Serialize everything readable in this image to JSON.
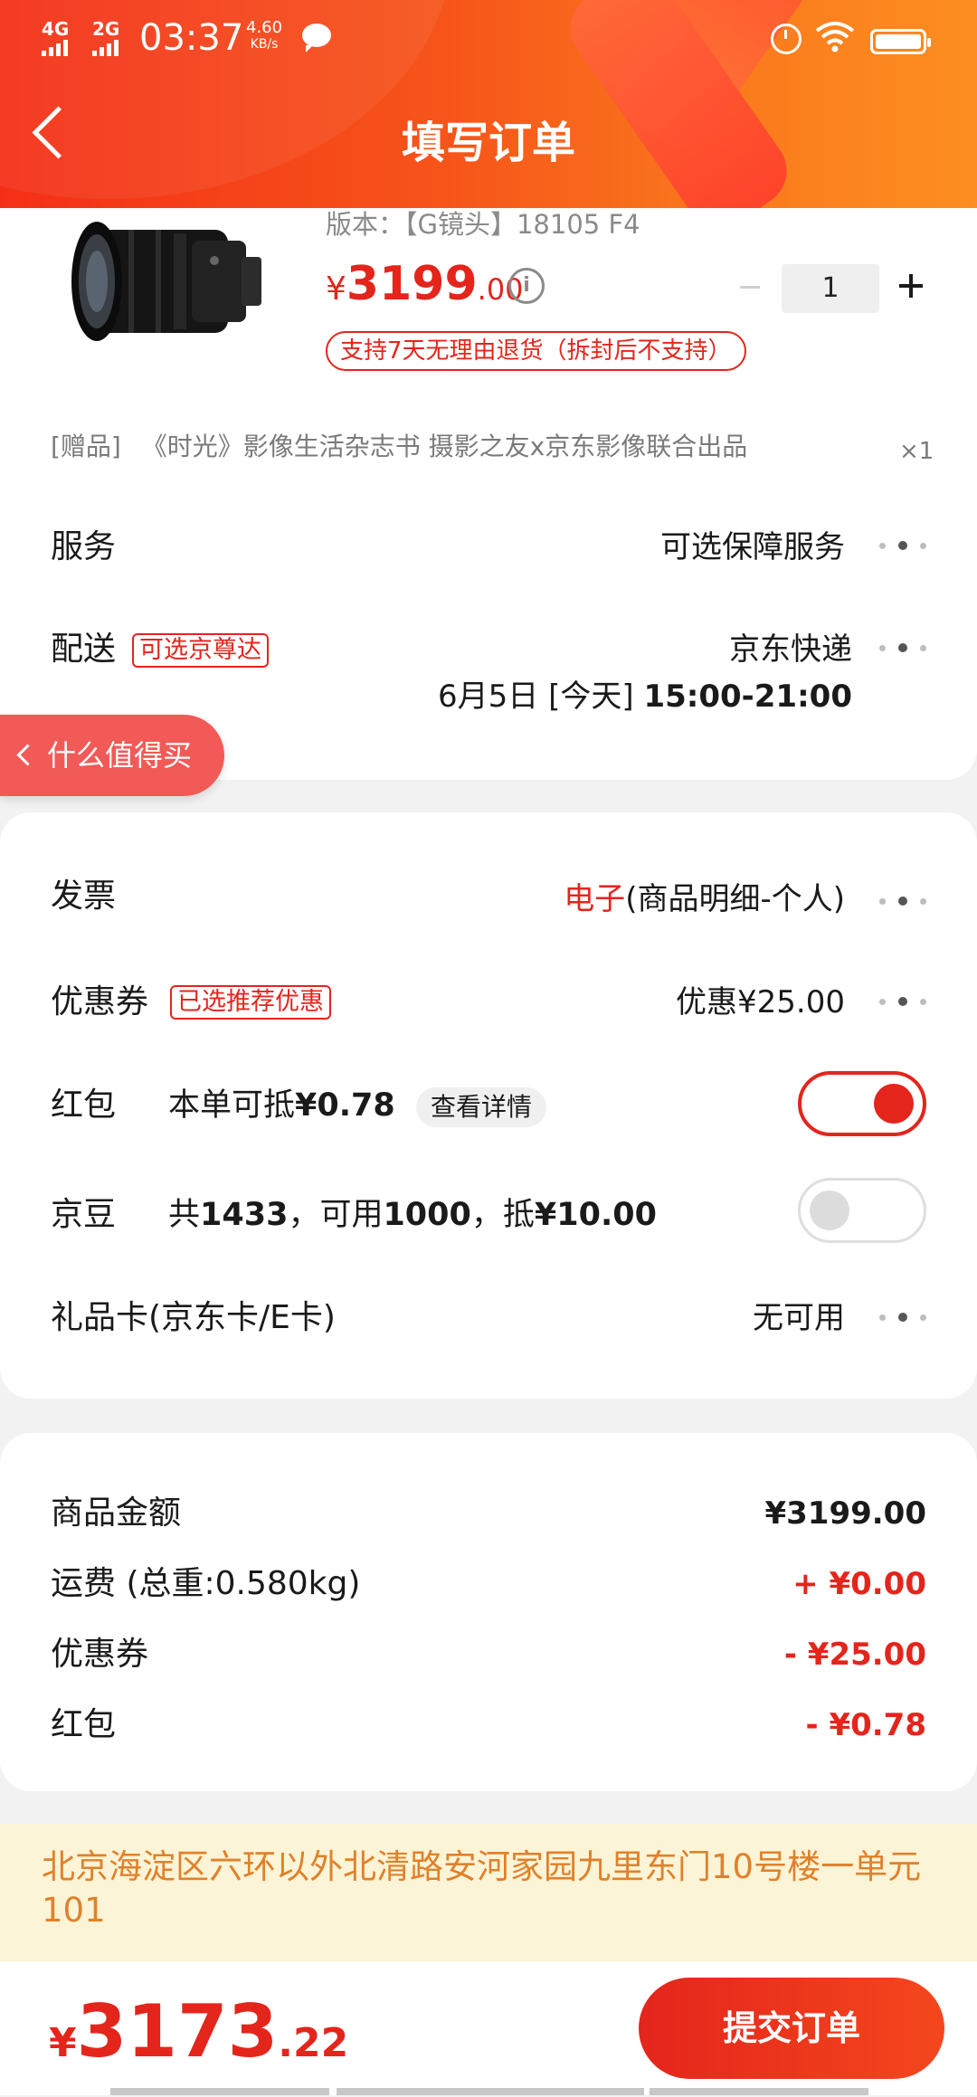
{
  "status_bar": {
    "net1": "4G",
    "net2": "2G",
    "time": "03:37",
    "speed_value": "4.60",
    "speed_unit": "KB/s"
  },
  "header": {
    "title": "填写订单"
  },
  "product": {
    "version": "版本：【G镜头】18105 F4",
    "currency": "¥",
    "price_int": "3199",
    "price_dec": ".00",
    "quantity": "1",
    "return_policy": "支持7天无理由退货（拆封后不支持）"
  },
  "gift": {
    "tag": "[赠品]",
    "name": "《时光》影像生活杂志书 摄影之友x京东影像联合出品",
    "qty": "×1"
  },
  "service": {
    "label": "服务",
    "value": "可选保障服务"
  },
  "delivery": {
    "label": "配送",
    "tag": "可选京尊达",
    "carrier": "京东快递",
    "time_prefix": "6月5日 [今天] ",
    "time_range": "15:00-21:00"
  },
  "floating_tab": {
    "label": "什么值得买"
  },
  "invoice": {
    "label": "发票",
    "type": "电子",
    "detail": "(商品明细-个人)"
  },
  "coupon": {
    "label": "优惠券",
    "tag": "已选推荐优惠",
    "value": "优惠¥25.00"
  },
  "red_packet": {
    "label": "红包",
    "text_prefix": "本单可抵",
    "amount": "¥0.78",
    "details_button": "查看详情",
    "enabled": true
  },
  "jingdou": {
    "label": "京豆",
    "t1": "共",
    "total": "1433",
    "t2": "，可用",
    "usable": "1000",
    "t3": "，抵",
    "deduct": "¥10.00",
    "enabled": false
  },
  "gift_card": {
    "label": "礼品卡(京东卡/E卡)",
    "value": "无可用"
  },
  "summary": {
    "items": [
      {
        "label": "商品金额",
        "value": "¥3199.00",
        "color": "#1a1a1a"
      },
      {
        "label": "运费  (总重:0.580kg)",
        "value": "+ ¥0.00",
        "color": "#e4251c"
      },
      {
        "label": "优惠券",
        "value": "- ¥25.00",
        "color": "#e4251c"
      },
      {
        "label": "红包",
        "value": "- ¥0.78",
        "color": "#e4251c"
      }
    ]
  },
  "address": {
    "text": "北京海淀区六环以外北清路安河家园九里东门10号楼一单元101"
  },
  "footer": {
    "currency": "¥",
    "total_int": "3173",
    "total_dec": ".22",
    "submit_label": "提交订单"
  },
  "colors": {
    "accent": "#e4251c",
    "header_start": "#f42f17",
    "header_end": "#fd8e21",
    "address_bg": "#fcf4d6",
    "address_text": "#e0812b"
  }
}
